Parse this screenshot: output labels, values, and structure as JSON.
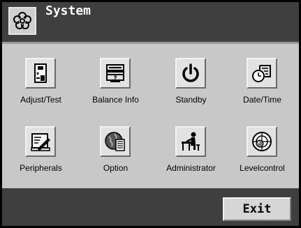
{
  "header": {
    "title": "System",
    "icon": "flower-settings-icon"
  },
  "tiles": [
    {
      "label": "Adjust/Test",
      "icon": "adjust-test-icon"
    },
    {
      "label": "Balance Info",
      "icon": "balance-info-icon"
    },
    {
      "label": "Standby",
      "icon": "power-icon"
    },
    {
      "label": "Date/Time",
      "icon": "date-time-icon"
    },
    {
      "label": "Peripherals",
      "icon": "peripherals-icon"
    },
    {
      "label": "Option",
      "icon": "globe-document-icon"
    },
    {
      "label": "Administrator",
      "icon": "administrator-icon"
    },
    {
      "label": "Levelcontrol",
      "icon": "level-control-icon"
    }
  ],
  "footer": {
    "exit_label": "Exit"
  },
  "colors": {
    "bar": "#3f3f3f",
    "panel": "#c8c8c8",
    "button": "#e2e2e2"
  }
}
